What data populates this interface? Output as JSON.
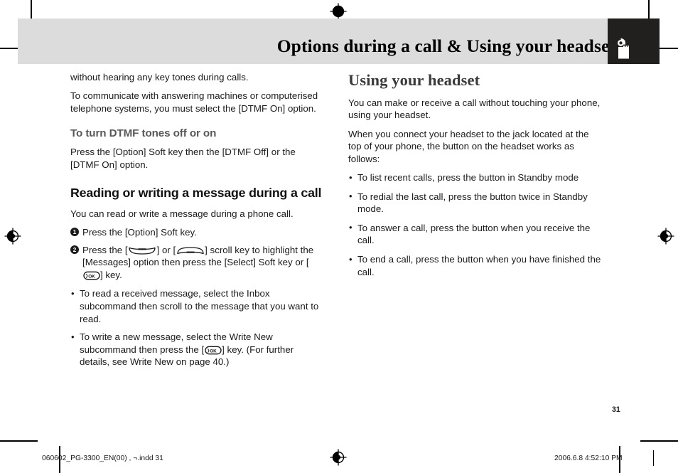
{
  "header": {
    "title": "Options during a call & Using your headset",
    "icon": "headset-icon",
    "band_color": "#dcdcdc",
    "icon_box_color": "#221f1f"
  },
  "left_column": {
    "paragraph_1": "without hearing any key tones during calls.",
    "paragraph_2": "To communicate with answering machines or computerised telephone systems, you must select the [DTMF On] option.",
    "subheading_1": "To turn DTMF tones off or on",
    "paragraph_3": "Press the [Option] Soft key then the [DTMF Off] or the [DTMF On] option.",
    "heading_1": "Reading or writing a message during a call",
    "paragraph_4": "You can read or write a message during a phone call.",
    "steps": [
      {
        "number": "1",
        "text": "Press the [Option] Soft key."
      },
      {
        "number": "2",
        "text_part_1": "Press the [",
        "key_1": "scroll-up-key",
        "text_part_2": "] or [",
        "key_2": "scroll-down-key",
        "text_part_3": "] scroll key to highlight the [Messages] option then press the [Select] Soft key or [",
        "key_3": "ok-key",
        "text_part_4": "] key."
      }
    ],
    "bullets": [
      {
        "text": "To read a received message, select the Inbox subcommand then scroll to the message that you want to read."
      },
      {
        "text_part_1": "To write a new message, select the Write New subcommand then press the [",
        "key_1": "ok-key",
        "text_part_2": "] key. (For further details, see Write New on page 40.)"
      }
    ]
  },
  "right_column": {
    "heading": "Using your headset",
    "paragraph_1": "You can make or receive a call without touching your phone, using your headset.",
    "paragraph_2": "When you connect your headset to the jack located at the top of your phone, the button on the headset works as follows:",
    "bullets": [
      "To list recent calls, press the button in Standby mode",
      "To redial the last call, press the button twice in Standby mode.",
      "To answer a call, press the button when you receive the call.",
      "To end a call, press the button when you have finished the call."
    ]
  },
  "page_number": "31",
  "footer": {
    "file_name": "060602_PG-3300_EN(00) , ¬.indd   31",
    "timestamp": "2006.6.8   4:52:10 PM"
  }
}
